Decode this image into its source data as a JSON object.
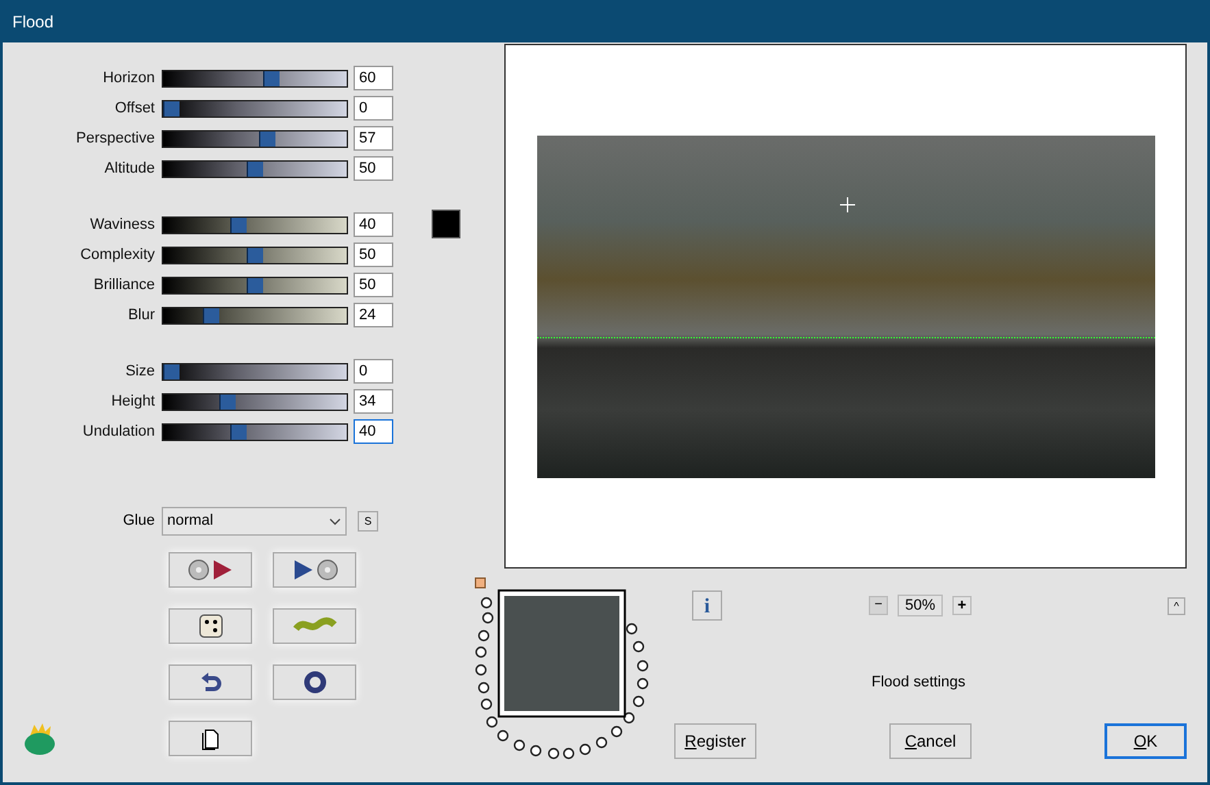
{
  "window": {
    "title": "Flood"
  },
  "slider_groups": [
    [
      {
        "label": "Horizon",
        "value": "60",
        "level": 0.6,
        "focused": false
      },
      {
        "label": "Offset",
        "value": "0",
        "level": 0,
        "focused": false
      },
      {
        "label": "Perspective",
        "value": "57",
        "level": 0.57,
        "focused": false
      },
      {
        "label": "Altitude",
        "value": "50",
        "level": 0.5,
        "focused": false
      }
    ],
    [
      {
        "label": "Waviness",
        "value": "40",
        "level": 0.4,
        "focused": false
      },
      {
        "label": "Complexity",
        "value": "50",
        "level": 0.5,
        "focused": false
      },
      {
        "label": "Brilliance",
        "value": "50",
        "level": 0.5,
        "focused": false
      },
      {
        "label": "Blur",
        "value": "24",
        "level": 0.24,
        "focused": false
      }
    ],
    [
      {
        "label": "Size",
        "value": "0",
        "level": 0,
        "focused": false
      },
      {
        "label": "Height",
        "value": "34",
        "level": 0.34,
        "focused": false
      },
      {
        "label": "Undulation",
        "value": "40",
        "level": 0.4,
        "focused": true
      }
    ]
  ],
  "glue": {
    "label": "Glue",
    "value": "normal",
    "side_button": "S"
  },
  "zoom": {
    "minus": "−",
    "value": "50%",
    "plus": "+",
    "collapse": "^"
  },
  "info_button": "i",
  "status": "Flood settings",
  "buttons": [
    {
      "label": "Register",
      "default": false
    },
    {
      "label": "Cancel",
      "default": false
    },
    {
      "label": "OK",
      "default": true
    }
  ]
}
